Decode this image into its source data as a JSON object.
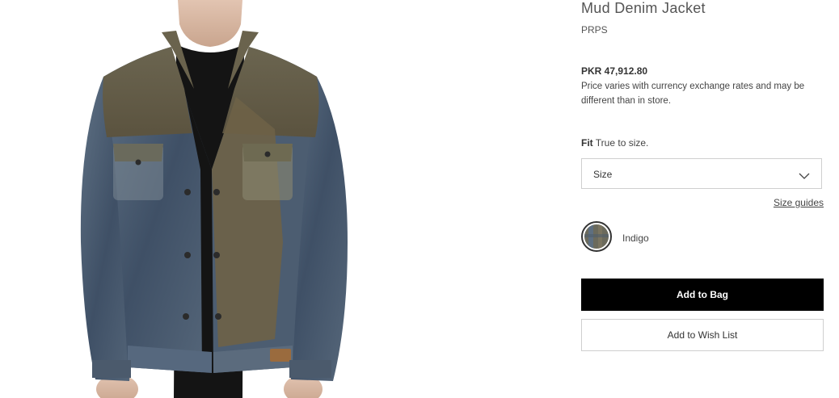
{
  "product": {
    "title": "Mud Denim Jacket",
    "brand": "PRPS",
    "price": "PKR 47,912.80",
    "price_note": "Price varies with currency exchange rates and may be different than in store."
  },
  "fit": {
    "label": "Fit",
    "value": "True to size."
  },
  "size": {
    "placeholder": "Size",
    "guides_label": "Size guides"
  },
  "color": {
    "name": "Indigo",
    "swatch_icon": "indigo-swatch"
  },
  "actions": {
    "add_to_bag": "Add to Bag",
    "add_to_wishlist": "Add to Wish List"
  },
  "colors": {
    "button_bg": "#000000",
    "border": "#cfcfcf",
    "text": "#393939"
  }
}
